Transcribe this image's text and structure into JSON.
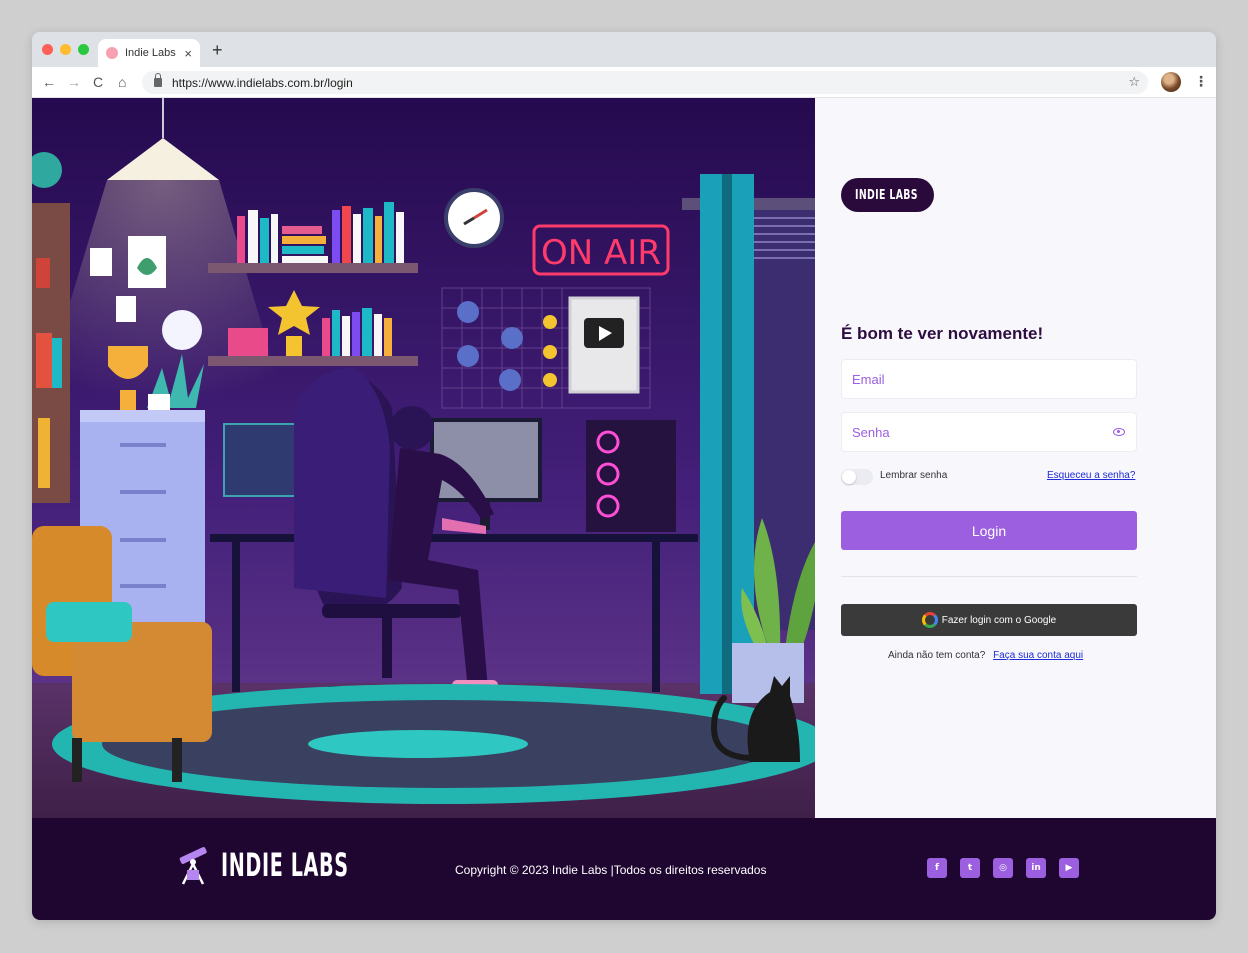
{
  "browser": {
    "tab_title": "Indie Labs",
    "tab_close": "×",
    "new_tab": "+",
    "url": "https://www.indielabs.com.br/login",
    "back": "←",
    "forward": "→",
    "reload": "C",
    "home": "⌂",
    "bookmark": "☆",
    "menu": "⋮"
  },
  "illustration": {
    "sign_text": "ON AIR"
  },
  "login": {
    "logo_text": "INDIE LABS",
    "welcome": "É bom te ver novamente!",
    "email_placeholder": "Email",
    "password_placeholder": "Senha",
    "remember_label": "Lembrar senha",
    "forgot_link": "Esqueceu a senha?",
    "login_button": "Login",
    "google_button": "Fazer login com o Google",
    "no_account_text": "Ainda não tem conta?",
    "signup_link": "Faça sua conta aqui"
  },
  "footer": {
    "logo_text": "INDIE LABS",
    "copyright": "Copyright © 2023 Indie Labs |Todos os direitos reservados",
    "socials": [
      {
        "name": "facebook",
        "glyph": "f"
      },
      {
        "name": "twitter",
        "glyph": "t"
      },
      {
        "name": "instagram",
        "glyph": "◎"
      },
      {
        "name": "linkedin",
        "glyph": "in"
      },
      {
        "name": "youtube",
        "glyph": "▶"
      }
    ]
  },
  "colors": {
    "accent": "#9b5fe0",
    "footer_bg": "#1f0630",
    "heading": "#2e0d40"
  }
}
